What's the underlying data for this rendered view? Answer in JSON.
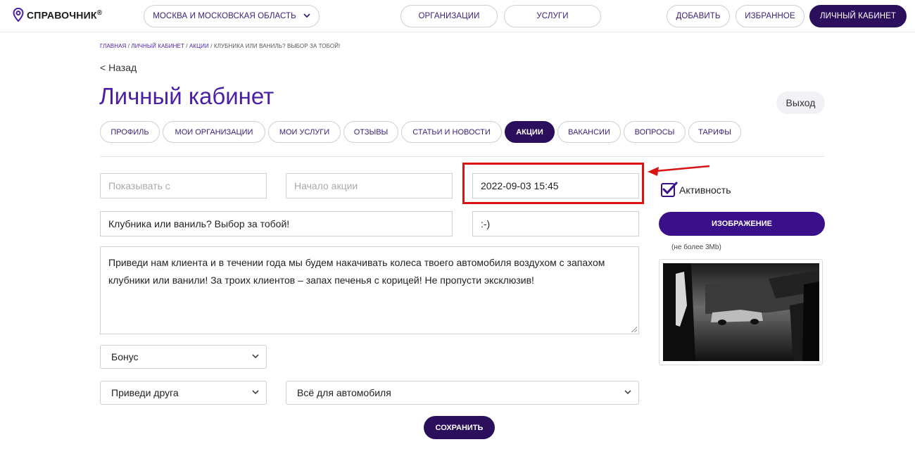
{
  "header": {
    "logo_text": "СПРАВОЧНИК",
    "logo_mark": "®",
    "region": "МОСКВА И МОСКОВСКАЯ ОБЛАСТЬ",
    "nav": {
      "organizations": "ОРГАНИЗАЦИИ",
      "services": "УСЛУГИ"
    },
    "actions": {
      "add": "ДОБАВИТЬ",
      "favorites": "ИЗБРАННОЕ",
      "account": "ЛИЧНЫЙ КАБИНЕТ"
    }
  },
  "breadcrumb": {
    "items": [
      "ГЛАВНАЯ",
      "ЛИЧНЫЙ КАБИНЕТ",
      "АКЦИИ"
    ],
    "separator": "/",
    "current": "КЛУБНИКА ИЛИ ВАНИЛЬ? ВЫБОР ЗА ТОБОЙ!"
  },
  "back_label": "< Назад",
  "page_title": "Личный кабинет",
  "logout_label": "Выход",
  "tabs": [
    {
      "label": "ПРОФИЛЬ"
    },
    {
      "label": "МОИ ОРГАНИЗАЦИИ"
    },
    {
      "label": "МОИ УСЛУГИ"
    },
    {
      "label": "ОТЗЫВЫ"
    },
    {
      "label": "СТАТЬИ И НОВОСТИ"
    },
    {
      "label": "АКЦИИ",
      "active": true
    },
    {
      "label": "ВАКАНСИИ"
    },
    {
      "label": "ВОПРОСЫ"
    },
    {
      "label": "ТАРИФЫ"
    }
  ],
  "form": {
    "show_from": {
      "value": "",
      "placeholder": "Показывать с"
    },
    "start": {
      "value": "",
      "placeholder": "Начало акции"
    },
    "end": {
      "value": "2022-09-03 15:45"
    },
    "title": {
      "value": "Клубника или ваниль? Выбор за тобой!"
    },
    "emoticon": {
      "value": ":-)"
    },
    "description": {
      "value": "Приведи нам клиента и в течении года мы будем накачивать колеса твоего автомобиля воздухом с запахом клубники или ванили! За троих клиентов – запах печенья с корицей! Не пропусти эксклюзив!"
    },
    "type_select": {
      "selected": "Бонус"
    },
    "kind_select": {
      "selected": "Приведи друга"
    },
    "category_select": {
      "selected": "Всё для автомобиля"
    },
    "save_label": "СОХРАНИТЬ"
  },
  "sidebar": {
    "active_label": "Активность",
    "active_checked": true,
    "image_button_label": "ИЗОБРАЖЕНИЕ",
    "size_note": "(не более 3Mb)"
  },
  "colors": {
    "brand_purple": "#4b1fa8",
    "dark_purple": "#2b0f5c",
    "button_purple": "#3a0f8a",
    "highlight_red": "#d81414"
  }
}
